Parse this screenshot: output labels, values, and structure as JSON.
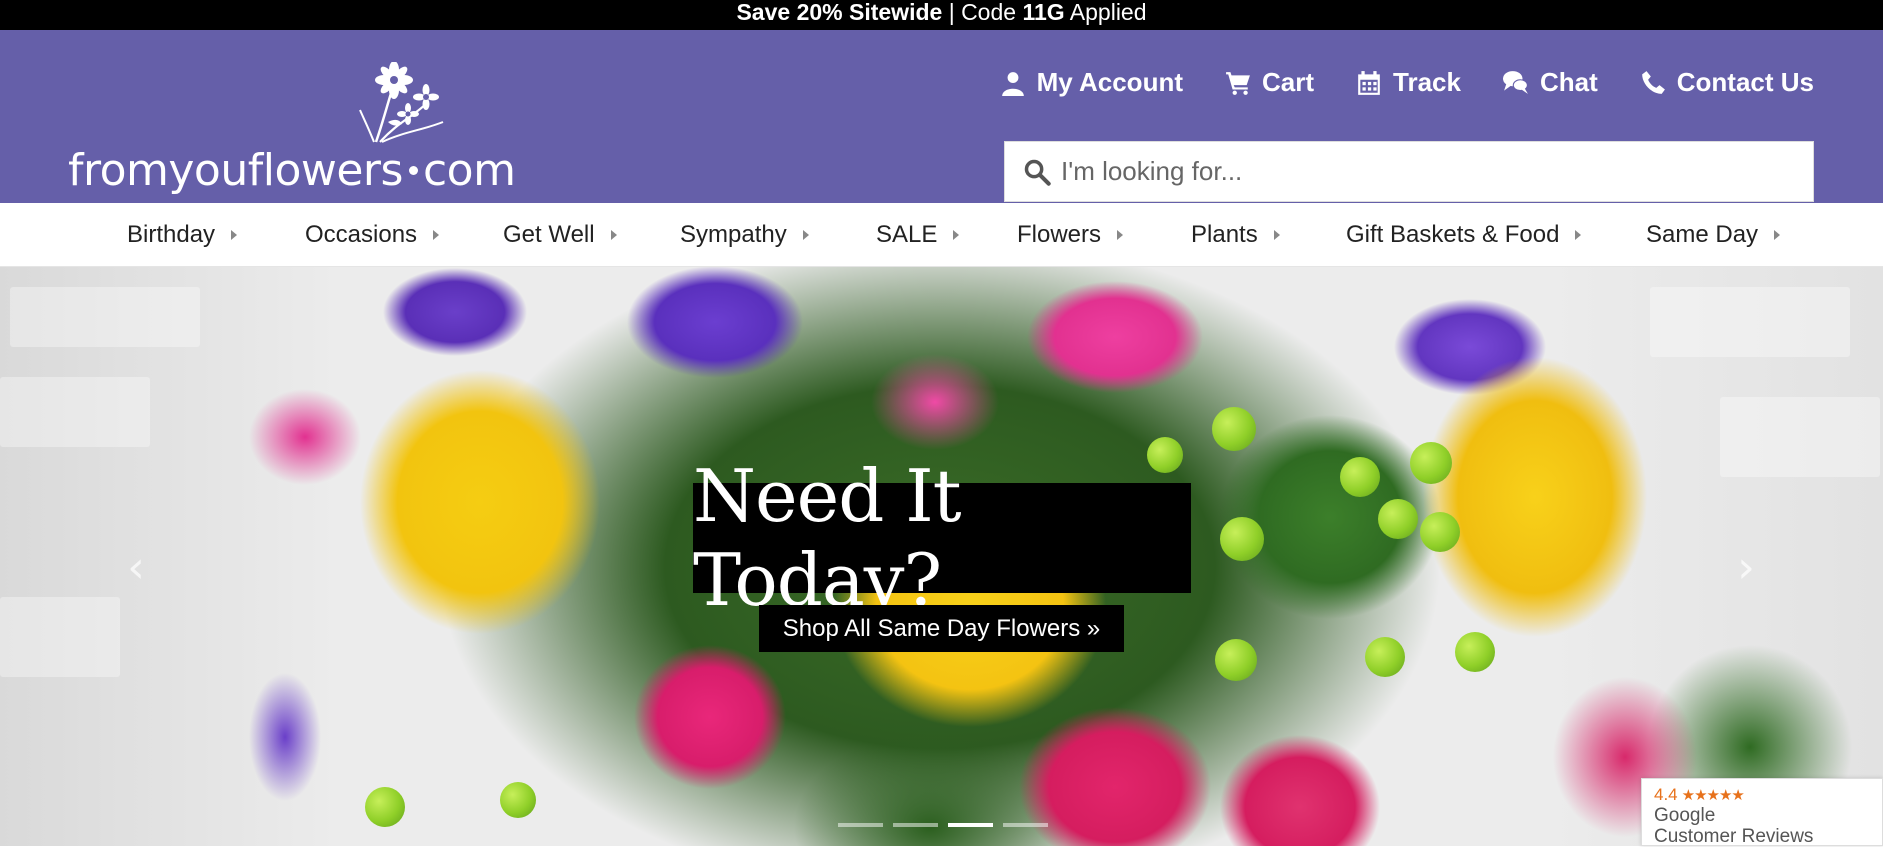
{
  "promo": {
    "bold_part": "Save 20% Sitewide",
    "separator": " | Code ",
    "code": "11G",
    "suffix": " Applied"
  },
  "logo": {
    "text_main": "fromyouflowers",
    "text_suffix": "com"
  },
  "top_links": [
    {
      "label": "My Account",
      "icon": "user-icon"
    },
    {
      "label": "Cart",
      "icon": "cart-icon"
    },
    {
      "label": "Track",
      "icon": "calendar-icon"
    },
    {
      "label": "Chat",
      "icon": "chat-icon"
    },
    {
      "label": "Contact Us",
      "icon": "phone-icon"
    }
  ],
  "search": {
    "placeholder": "I'm looking for..."
  },
  "nav": {
    "items": [
      {
        "label": "Birthday"
      },
      {
        "label": "Occasions"
      },
      {
        "label": "Get Well"
      },
      {
        "label": "Sympathy"
      },
      {
        "label": "SALE"
      },
      {
        "label": "Flowers"
      },
      {
        "label": "Plants"
      },
      {
        "label": "Gift Baskets & Food"
      },
      {
        "label": "Same Day"
      }
    ]
  },
  "hero": {
    "headline": "Need It Today?",
    "cta": "Shop All Same Day Flowers »",
    "prev_icon": "‹",
    "next_icon": "›",
    "slide_count": 4,
    "active_slide": 3
  },
  "reviews_badge": {
    "rating": "4.4",
    "stars": "★★★★★",
    "line1": "Google",
    "line2": "Customer Reviews"
  },
  "colors": {
    "header_bg": "#655fa9",
    "promo_bg": "#000000",
    "nav_text": "#222222"
  }
}
